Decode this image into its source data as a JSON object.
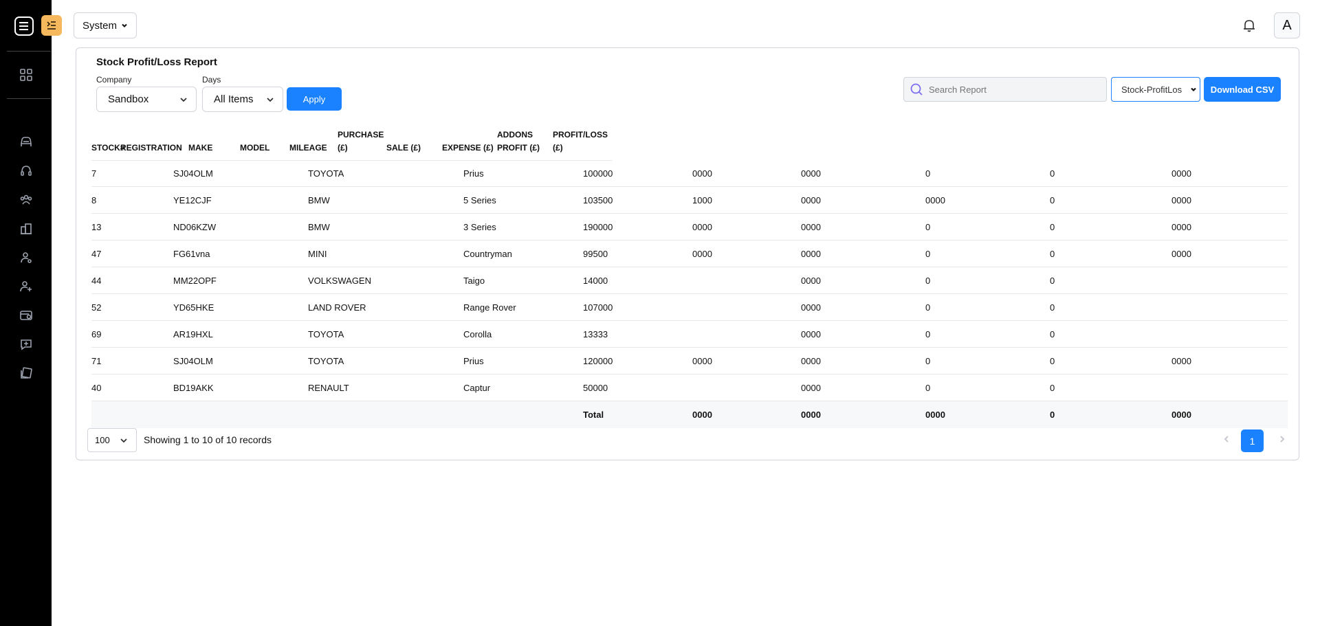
{
  "header": {
    "system_label": "System",
    "avatar_letter": "A"
  },
  "report": {
    "title": "Stock Profit/Loss Report",
    "company_label": "Company",
    "company_value": "Sandbox",
    "days_label": "Days",
    "days_value": "All Items",
    "apply_label": "Apply",
    "search_placeholder": "Search Report",
    "report_type": "Stock-ProfitLos",
    "download_label": "Download CSV"
  },
  "table": {
    "columns": [
      {
        "l1": "",
        "l2": "STOCK#"
      },
      {
        "l1": "",
        "l2": "REGISTRATION"
      },
      {
        "l1": "",
        "l2": "MAKE"
      },
      {
        "l1": "",
        "l2": "MODEL"
      },
      {
        "l1": "",
        "l2": "MILEAGE"
      },
      {
        "l1": "PURCHASE",
        "l2": "(£)"
      },
      {
        "l1": "",
        "l2": "SALE (£)"
      },
      {
        "l1": "",
        "l2": "EXPENSE (£)"
      },
      {
        "l1": "ADDONS",
        "l2": "PROFIT (£)"
      },
      {
        "l1": "PROFIT/LOSS",
        "l2": "(£)"
      }
    ],
    "rows": [
      [
        "7",
        "SJ04OLM",
        "TOYOTA",
        "Prius",
        "100000",
        "0000",
        "0000",
        "0",
        "0",
        "0000"
      ],
      [
        "8",
        "YE12CJF",
        "BMW",
        "5 Series",
        "103500",
        "1000",
        "0000",
        "0000",
        "0",
        "0000"
      ],
      [
        "13",
        "ND06KZW",
        "BMW",
        "3 Series",
        "190000",
        "0000",
        "0000",
        "0",
        "0",
        "0000"
      ],
      [
        "47",
        "FG61vna",
        "MINI",
        "Countryman",
        "99500",
        "0000",
        "0000",
        "0",
        "0",
        "0000"
      ],
      [
        "44",
        "MM22OPF",
        "VOLKSWAGEN",
        "Taigo",
        "14000",
        "",
        "0000",
        "0",
        "0",
        ""
      ],
      [
        "52",
        "YD65HKE",
        "LAND ROVER",
        "Range Rover",
        "107000",
        "",
        "0000",
        "0",
        "0",
        ""
      ],
      [
        "69",
        "AR19HXL",
        "TOYOTA",
        "Corolla",
        "13333",
        "",
        "0000",
        "0",
        "0",
        ""
      ],
      [
        "71",
        "SJ04OLM",
        "TOYOTA",
        "Prius",
        "120000",
        "0000",
        "0000",
        "0",
        "0",
        "0000"
      ],
      [
        "40",
        "BD19AKK",
        "RENAULT",
        "Captur",
        "50000",
        "",
        "0000",
        "0",
        "0",
        ""
      ]
    ],
    "total": [
      "",
      "",
      "",
      "",
      "Total",
      "0000",
      "0000",
      "0000",
      "0",
      "0000"
    ]
  },
  "pagination": {
    "per_page": "100",
    "records_text": "Showing 1 to 10 of 10 records",
    "current_page": "1"
  }
}
